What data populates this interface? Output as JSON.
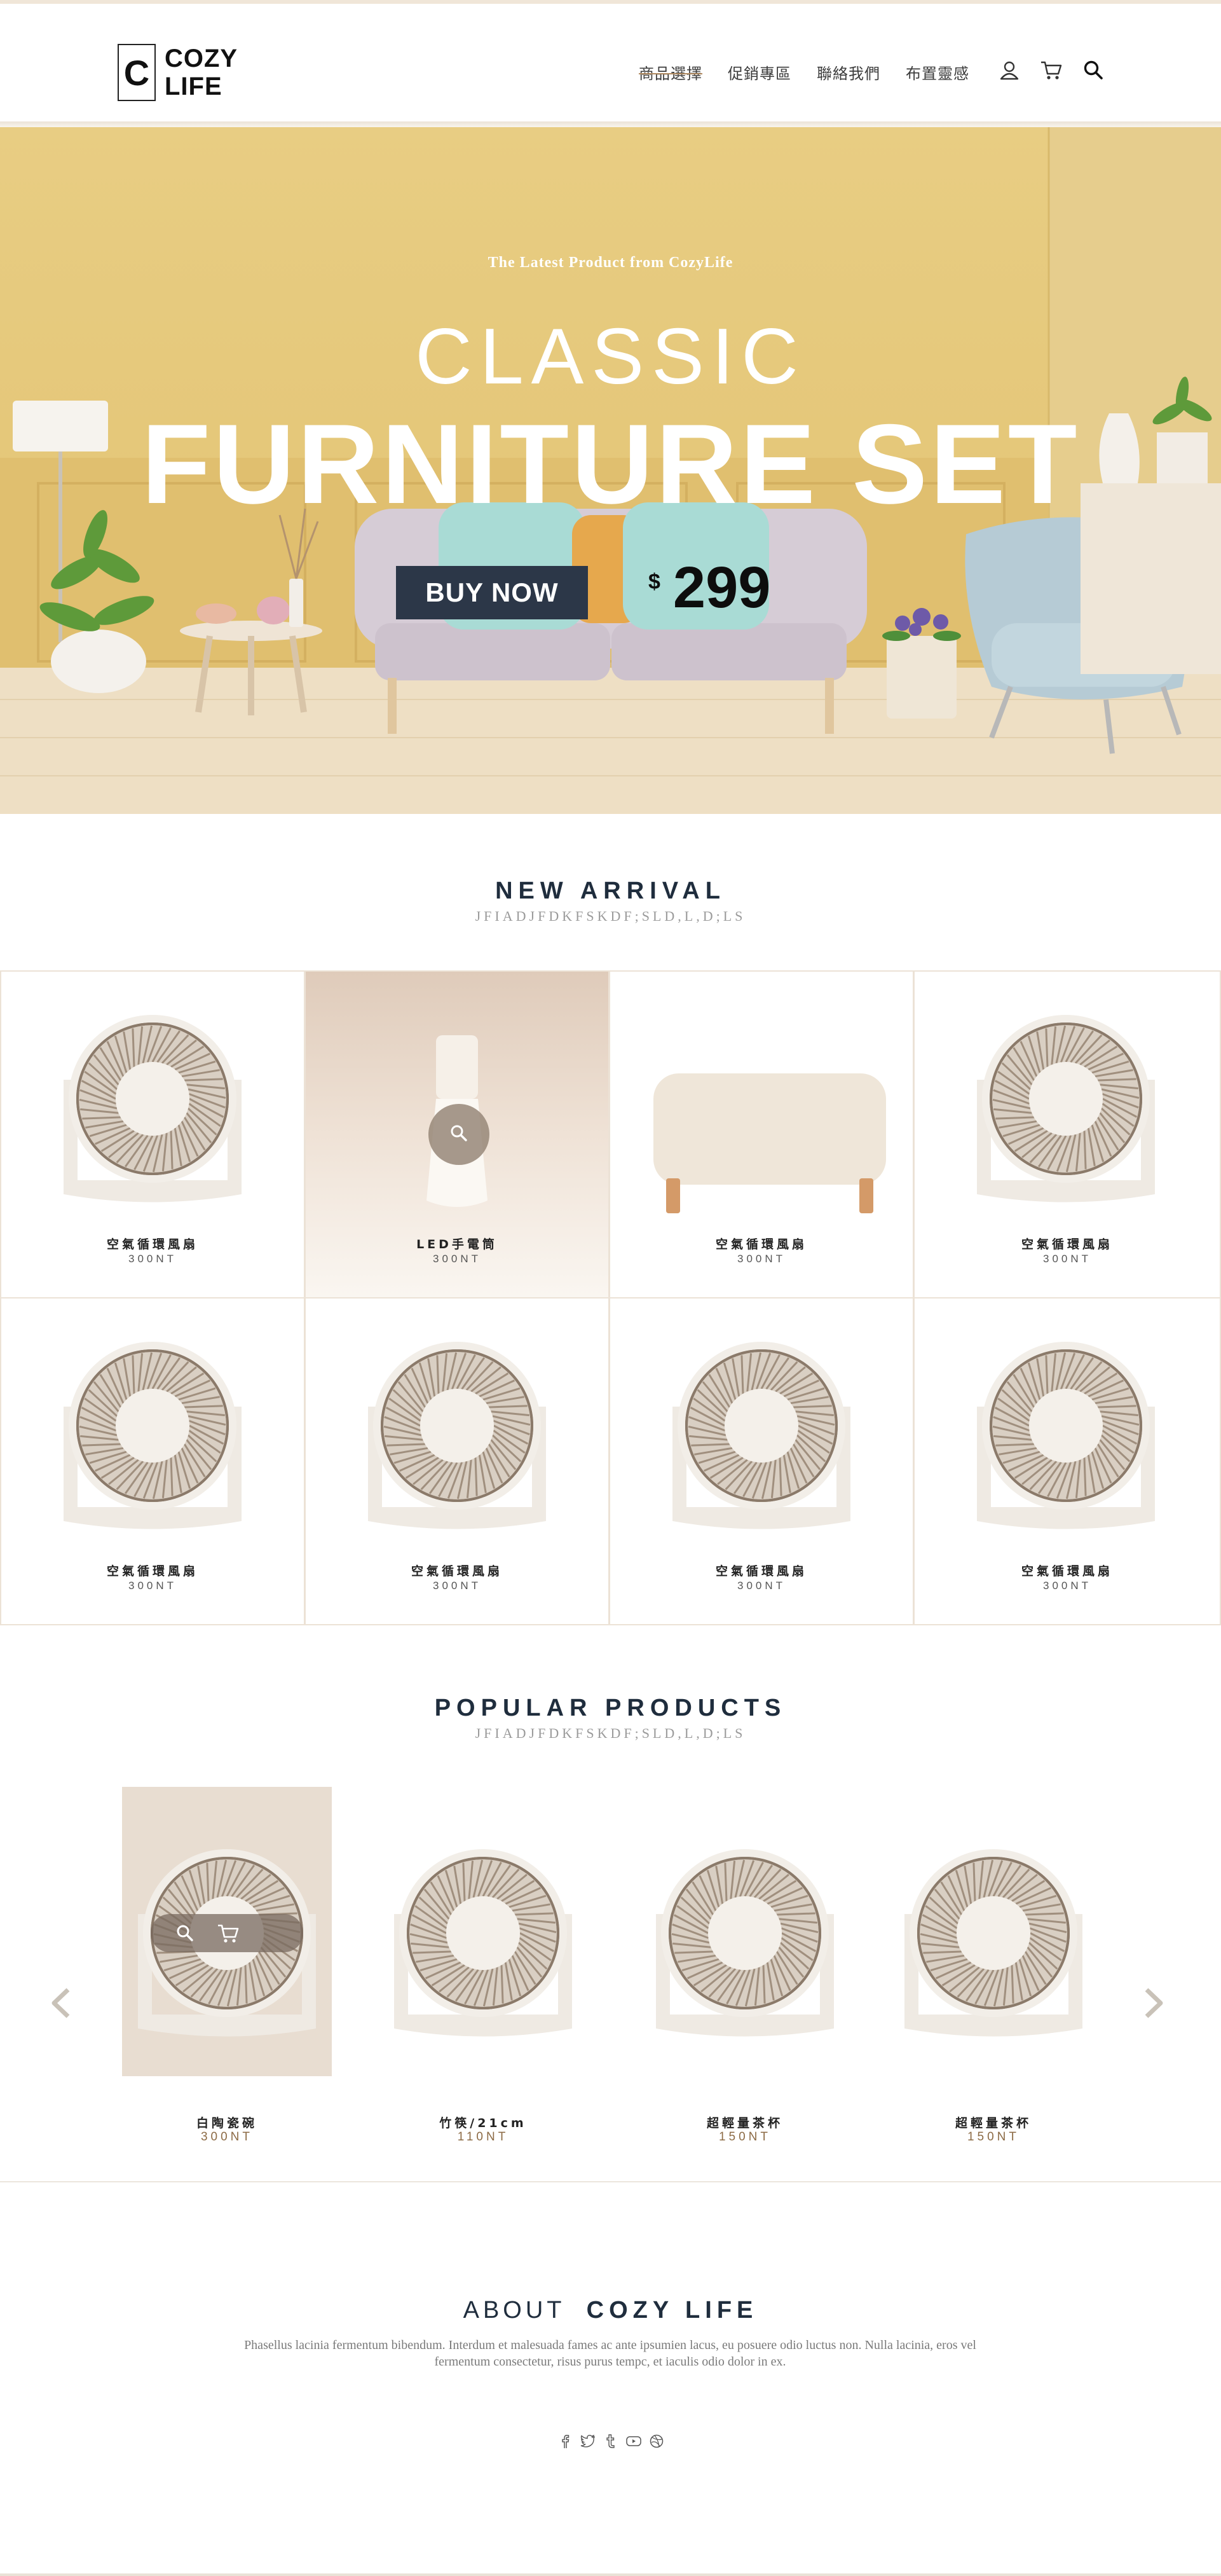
{
  "header": {
    "logo_mark": "C",
    "logo_line1": "COZY",
    "logo_line2": "LIFE",
    "nav": [
      "商品選擇",
      "促銷專區",
      "聯絡我們",
      "布置靈感"
    ],
    "icons": [
      "user-icon",
      "cart-icon",
      "search-icon"
    ]
  },
  "hero": {
    "tagline": "The Latest Product from CozyLife",
    "title_line1": "CLASSIC",
    "title_line2": "FURNITURE SET",
    "button_label": "BUY NOW",
    "price_currency": "$",
    "price_amount": "299"
  },
  "new_arrival": {
    "title": "NEW ARRIVAL",
    "subtitle": "JFIADJFDKFSKDF;SLD,L,D;LS",
    "items": [
      {
        "name": "空氣循環風扇",
        "price": "300NT",
        "image": "fan"
      },
      {
        "name": "LED手電筒",
        "price": "300NT",
        "image": "lamp"
      },
      {
        "name": "空氣循環風扇",
        "price": "300NT",
        "image": "ottoman"
      },
      {
        "name": "空氣循環風扇",
        "price": "300NT",
        "image": "fan"
      },
      {
        "name": "空氣循環風扇",
        "price": "300NT",
        "image": "fan"
      },
      {
        "name": "空氣循環風扇",
        "price": "300NT",
        "image": "fan"
      },
      {
        "name": "空氣循環風扇",
        "price": "300NT",
        "image": "fan"
      },
      {
        "name": "空氣循環風扇",
        "price": "300NT",
        "image": "fan"
      }
    ]
  },
  "popular": {
    "title": "POPULAR PRODUCTS",
    "subtitle": "JFIADJFDKFSKDF;SLD,L,D;LS",
    "items": [
      {
        "name": "白陶瓷碗",
        "price": "300NT"
      },
      {
        "name": "竹筷/21cm",
        "price": "110NT"
      },
      {
        "name": "超輕量茶杯",
        "price": "150NT"
      },
      {
        "name": "超輕量茶杯",
        "price": "150NT"
      }
    ]
  },
  "about": {
    "title_prefix": "ABOUT",
    "title_brand": "COZY LIFE",
    "text": "Phasellus lacinia fermentum bibendum. Interdum et malesuada fames ac ante ipsumien lacus, eu posuere odio luctus non. Nulla lacinia, eros vel fermentum consectetur, risus purus tempc, et iaculis odio dolor in ex.",
    "social": [
      "facebook-icon",
      "twitter-icon",
      "tumblr-icon",
      "youtube-icon",
      "dribbble-icon"
    ]
  },
  "colors": {
    "brand_dark": "#2c3748",
    "hero_wall": "#e4c677",
    "border": "#ece2d6",
    "price_accent": "#8c6a44"
  }
}
